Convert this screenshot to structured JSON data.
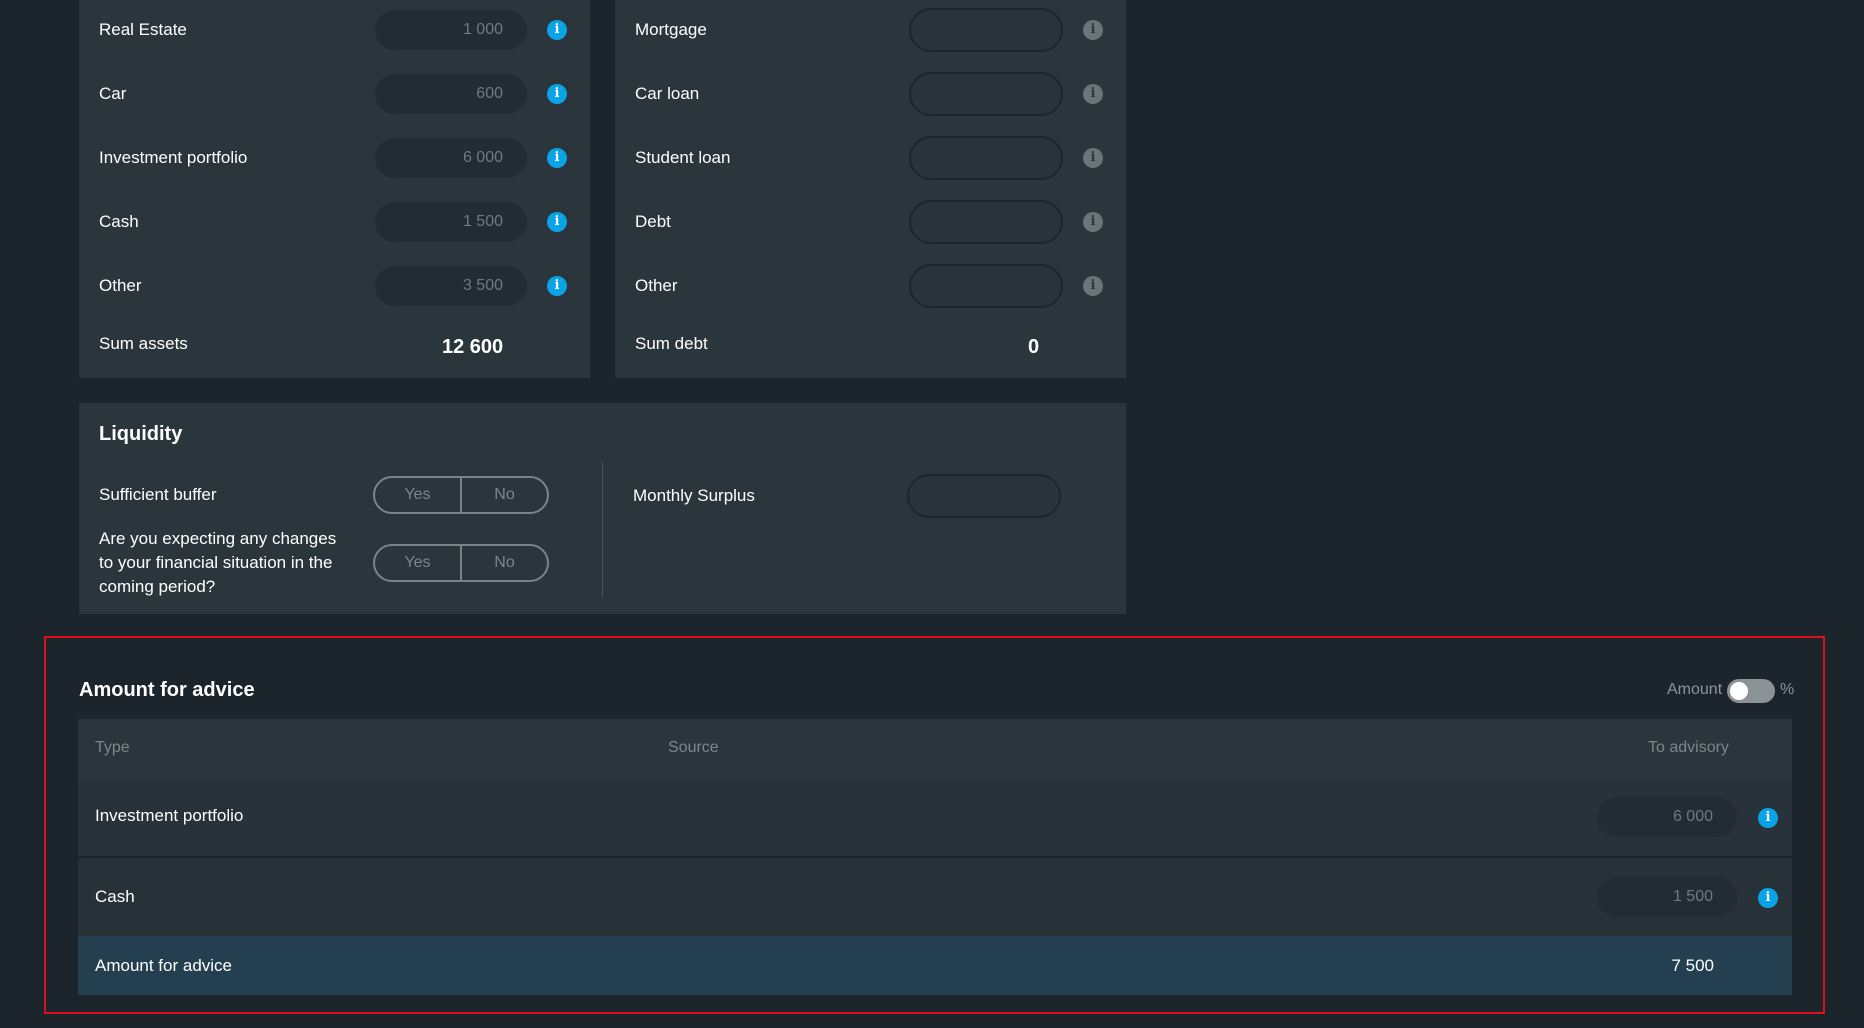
{
  "assets": {
    "rows": [
      {
        "label": "Real Estate",
        "value": "1 000"
      },
      {
        "label": "Car",
        "value": "600"
      },
      {
        "label": "Investment portfolio",
        "value": "6 000"
      },
      {
        "label": "Cash",
        "value": "1 500"
      },
      {
        "label": "Other",
        "value": "3 500"
      }
    ],
    "sum_label": "Sum assets",
    "sum_value": "12 600"
  },
  "debts": {
    "rows": [
      {
        "label": "Mortgage",
        "value": ""
      },
      {
        "label": "Car loan",
        "value": ""
      },
      {
        "label": "Student loan",
        "value": ""
      },
      {
        "label": "Debt",
        "value": ""
      },
      {
        "label": "Other",
        "value": ""
      }
    ],
    "sum_label": "Sum debt",
    "sum_value": "0"
  },
  "liquidity": {
    "title": "Liquidity",
    "buffer_label": "Sufficient buffer",
    "changes_label": "Are you expecting any changes to your financial situation in the coming period?",
    "yes": "Yes",
    "no": "No",
    "surplus_label": "Monthly Surplus",
    "surplus_value": ""
  },
  "advice": {
    "title": "Amount for advice",
    "toggle_left": "Amount",
    "toggle_right": "%",
    "columns": {
      "type": "Type",
      "source": "Source",
      "to_advisory": "To advisory"
    },
    "rows": [
      {
        "label": "Investment portfolio",
        "value": "6 000"
      },
      {
        "label": "Cash",
        "value": "1 500"
      }
    ],
    "total_label": "Amount for advice",
    "total_value": "7 500"
  },
  "colors": {
    "info_blue": "#0aa4e6",
    "highlight_border": "#e0101a"
  }
}
